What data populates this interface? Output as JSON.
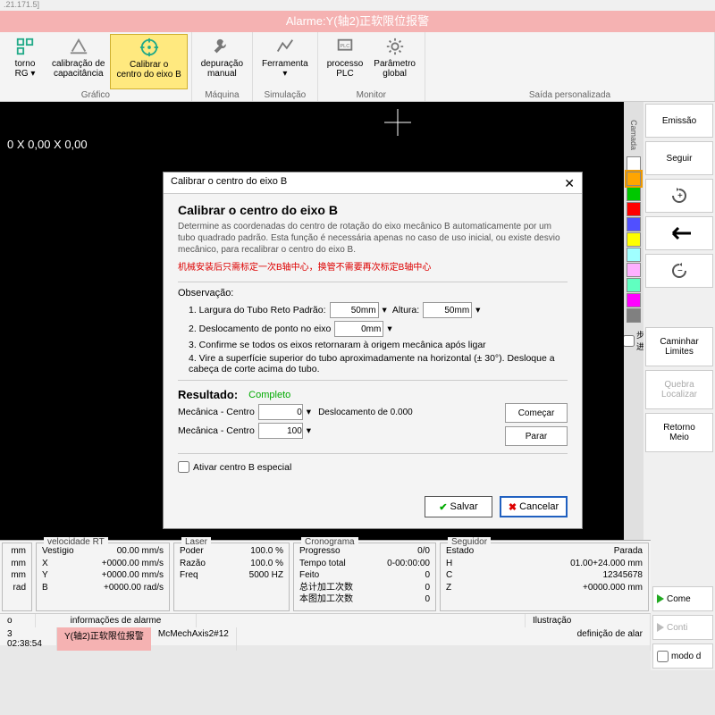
{
  "titlebar": ".21.171.5]",
  "alarm_bar": "Alarme:Y(轴2)正软限位报警",
  "ribbon": {
    "groups": [
      {
        "label": "Gráfico",
        "btns": [
          {
            "name": "torno-rg",
            "label": "torno\nRG ▾"
          },
          {
            "name": "calib-cap",
            "label": "calibração de\ncapacitância"
          },
          {
            "name": "calib-b",
            "label": "Calibrar o\ncentro do eixo B",
            "selected": true
          }
        ]
      },
      {
        "label": "Máquina",
        "btns": [
          {
            "name": "debug-manual",
            "label": "depuração\nmanual"
          }
        ]
      },
      {
        "label": "Simulação",
        "btns": [
          {
            "name": "ferramenta",
            "label": "Ferramenta\n▾"
          }
        ]
      },
      {
        "label": "Monitor",
        "btns": [
          {
            "name": "plc",
            "label": "processo\nPLC"
          },
          {
            "name": "param-global",
            "label": "Parâmetro\nglobal"
          }
        ]
      },
      {
        "label": "Saída personalizada",
        "btns": []
      }
    ]
  },
  "canvas": {
    "coords": "0 X 0,00 X 0,00"
  },
  "colors": {
    "label": "Camada",
    "steps_ck": "步进",
    "list": [
      "#ffffff",
      "#ffa500",
      "#00c800",
      "#ff0000",
      "#5050ff",
      "#ffff00",
      "#a0ffff",
      "#ffb0ff",
      "#60ffc0",
      "#ff00ff",
      "#808080"
    ]
  },
  "right": {
    "emissao": "Emissão",
    "seguir": "Seguir",
    "btns": [
      {
        "name": "rot-cw",
        "icon": "rotcw"
      },
      {
        "name": "arrow-left",
        "icon": "aleft"
      },
      {
        "name": "rot-ccw",
        "icon": "rotccw"
      }
    ],
    "caminhar": "Caminhar\nLimites",
    "quebra": "Quebra\nLocalizar",
    "retorno": "Retorno\nMeio"
  },
  "dialog": {
    "title": "Calibrar o centro do eixo B",
    "heading": "Calibrar o centro do eixo B",
    "desc": "Determine as coordenadas do centro de rotação do eixo mecânico B automaticamente por um tubo quadrado padrão. Esta função é necessária apenas no caso de uso inicial, ou existe desvio mecânico, para recalibrar o centro do eixo B.",
    "red": "机械安装后只需标定一次B轴中心，换管不需要再次标定B轴中心",
    "obs": "Observação:",
    "l1": "1. Largura do Tubo Reto Padrão:",
    "l1v": "50mm",
    "alt": "Altura:",
    "altv": "50mm",
    "l2": "2. Deslocamento de ponto no eixo",
    "l2v": "0mm",
    "l3": "3. Confirme se todos os eixos retornaram à origem mecânica após ligar",
    "l4": "4. Vire a superfície superior do tubo aproximadamente na horizontal (± 30°). Desloque a cabeça de corte acima do tubo.",
    "result": "Resultado:",
    "status": "Completo",
    "mech1": "Mecânica - Centro",
    "mech1v": "0",
    "desl": "Deslocamento de 0.000",
    "mech2": "Mecânica - Centro",
    "mech2v": "100",
    "comecar": "Começar",
    "parar": "Parar",
    "ck": "Ativar centro B especial",
    "salvar": "Salvar",
    "cancelar": "Cancelar"
  },
  "status": {
    "units": {
      "a": "mm",
      "b": "mm",
      "c": "mm",
      "d": "rad"
    },
    "rt": {
      "title": "velocidade RT",
      "vest": "Vestígio",
      "vestv": "00.00",
      "u": "mm/s",
      "rows": [
        [
          "X",
          "+0000.00",
          "mm/s"
        ],
        [
          "Y",
          "+0000.00",
          "mm/s"
        ],
        [
          "B",
          "+0000.00",
          "rad/s"
        ]
      ]
    },
    "laser": {
      "title": "Laser",
      "rows": [
        [
          "Poder",
          "100.0",
          "%"
        ],
        [
          "Razão",
          "100.0",
          "%"
        ],
        [
          "Freq",
          "5000",
          "HZ"
        ]
      ]
    },
    "crono": {
      "title": "Cronograma",
      "rows": [
        [
          "Progresso",
          "0/0"
        ],
        [
          "Tempo total",
          "0-00:00:00"
        ],
        [
          "Feito",
          "0"
        ],
        [
          "总计加工次数",
          "0"
        ],
        [
          "本图加工次数",
          "0"
        ]
      ]
    },
    "seg": {
      "title": "Seguidor",
      "estado": "Estado",
      "parada": "Parada",
      "rows": [
        [
          "H",
          "01.00+24.000",
          "mm"
        ],
        [
          "C",
          "12345678",
          ""
        ],
        [
          "Z",
          "+0000.000",
          "mm"
        ]
      ]
    }
  },
  "bottom": {
    "o": "o",
    "time": "3 02:38:54",
    "info_label": "informações de alarme",
    "alarm": "Y(轴2)正软限位报警",
    "mc": "McMechAxis2#12",
    "il": "Ilustração",
    "def": "definição de alar"
  },
  "actions": {
    "come": "Come",
    "conti": "Conti",
    "modo": "modo d"
  }
}
